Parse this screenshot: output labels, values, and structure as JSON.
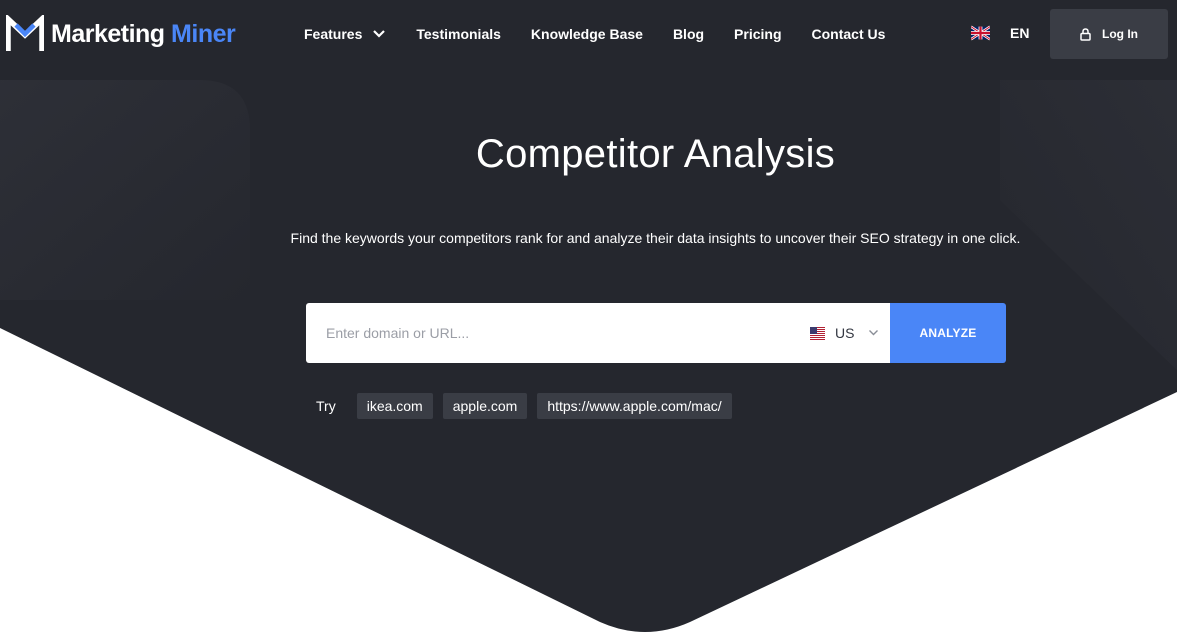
{
  "brand": {
    "name_part1": "Marketing",
    "name_part2": "Miner",
    "logo_icon": "mm-logo-icon",
    "accent_color": "#4a86f7"
  },
  "nav": {
    "items": [
      {
        "label": "Features",
        "has_dropdown": true,
        "icon": "chevron-down-icon"
      },
      {
        "label": "Testimonials"
      },
      {
        "label": "Knowledge Base"
      },
      {
        "label": "Blog"
      },
      {
        "label": "Pricing"
      },
      {
        "label": "Contact Us"
      }
    ],
    "language": {
      "code": "EN",
      "icon": "uk-flag-icon"
    },
    "login": {
      "label": "Log In",
      "icon": "lock-icon"
    }
  },
  "hero": {
    "title": "Competitor Analysis",
    "subtitle": "Find the keywords your competitors rank for and analyze their data insights to uncover their SEO strategy in one click.",
    "background_color": "#25272e"
  },
  "search": {
    "placeholder": "Enter domain or URL...",
    "value": "",
    "country": {
      "code": "US",
      "icon": "us-flag-icon"
    },
    "analyze_label": "ANALYZE"
  },
  "try": {
    "label": "Try",
    "examples": [
      "ikea.com",
      "apple.com",
      "https://www.apple.com/mac/"
    ]
  }
}
